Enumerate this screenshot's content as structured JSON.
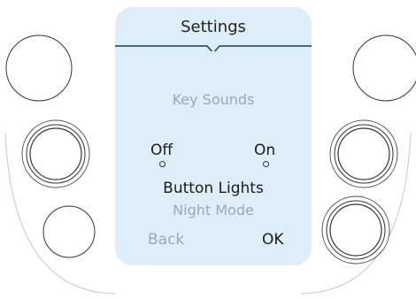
{
  "screen": {
    "title": "Settings",
    "setting_name": "Key Sounds",
    "options": {
      "off_label": "Off",
      "on_label": "On"
    },
    "menu": {
      "selected": "Button Lights",
      "next": "Night Mode"
    },
    "softkeys": {
      "back_label": "Back",
      "ok_label": "OK"
    }
  },
  "colors": {
    "screen_bg": "#ddeef9",
    "title_rule": "#1a3a5c",
    "dim_text": "#9aa9b5",
    "body_text": "#1b1b1b"
  }
}
